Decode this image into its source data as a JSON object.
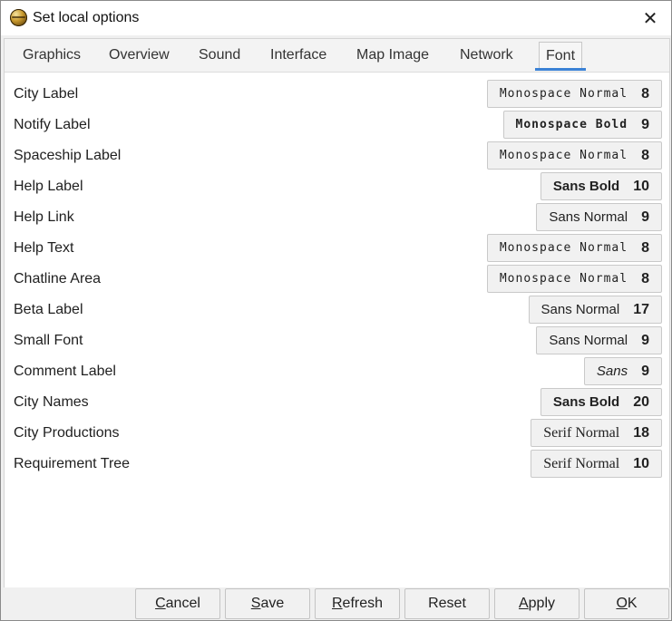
{
  "window": {
    "title": "Set local options"
  },
  "tabs": [
    {
      "label": "Graphics"
    },
    {
      "label": "Overview"
    },
    {
      "label": "Sound"
    },
    {
      "label": "Interface"
    },
    {
      "label": "Map Image"
    },
    {
      "label": "Network"
    },
    {
      "label": "Font",
      "active": true
    }
  ],
  "fonts": [
    {
      "label": "City Label",
      "font": "Monospace Normal",
      "size": "8"
    },
    {
      "label": "Notify Label",
      "font": "Monospace Bold",
      "size": "9"
    },
    {
      "label": "Spaceship Label",
      "font": "Monospace Normal",
      "size": "8"
    },
    {
      "label": "Help Label",
      "font": "Sans Bold",
      "size": "10"
    },
    {
      "label": "Help Link",
      "font": "Sans Normal",
      "size": "9"
    },
    {
      "label": "Help Text",
      "font": "Monospace Normal",
      "size": "8"
    },
    {
      "label": "Chatline Area",
      "font": "Monospace Normal",
      "size": "8"
    },
    {
      "label": "Beta Label",
      "font": "Sans Normal",
      "size": "17"
    },
    {
      "label": "Small Font",
      "font": "Sans Normal",
      "size": "9"
    },
    {
      "label": "Comment Label",
      "font": "Sans",
      "size": "9"
    },
    {
      "label": "City Names",
      "font": "Sans Bold",
      "size": "20"
    },
    {
      "label": "City Productions",
      "font": "Serif Normal",
      "size": "18"
    },
    {
      "label": "Requirement Tree",
      "font": "Serif Normal",
      "size": "10"
    }
  ],
  "buttons": {
    "cancel": {
      "first": "C",
      "rest": "ancel"
    },
    "save": {
      "first": "S",
      "rest": "ave"
    },
    "refresh": {
      "first": "R",
      "rest": "efresh"
    },
    "reset": {
      "label": "Reset"
    },
    "apply": {
      "first": "A",
      "rest": "pply"
    },
    "ok": {
      "first": "O",
      "rest": "K"
    }
  },
  "accent_color": "#3b82d6"
}
